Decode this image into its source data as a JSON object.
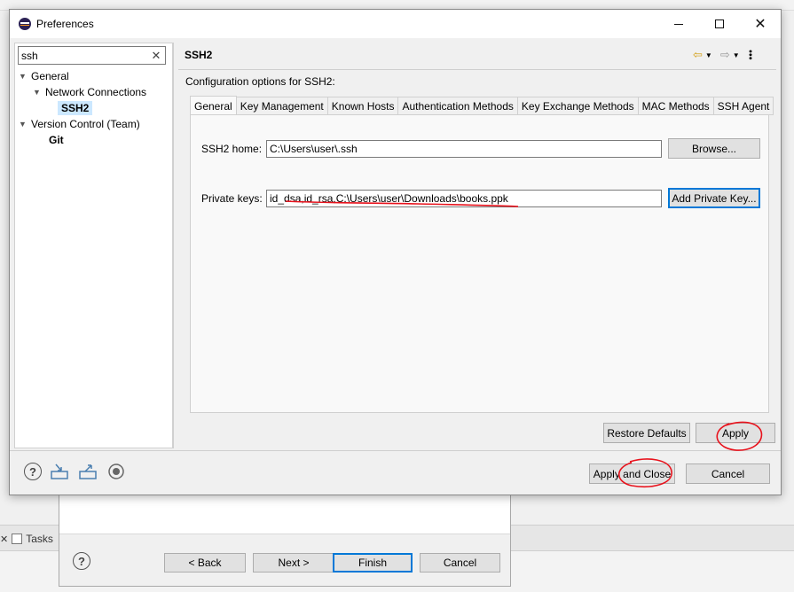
{
  "background": {
    "tasks_label": "Tasks"
  },
  "wizard": {
    "back_label": "< Back",
    "next_label": "Next >",
    "finish_label": "Finish",
    "cancel_label": "Cancel"
  },
  "dialog": {
    "title": "Preferences",
    "icon": "eclipse-icon"
  },
  "filter": {
    "value": "ssh",
    "clear_icon": "clear-icon"
  },
  "tree": {
    "general": "General",
    "network": "Network Connections",
    "ssh2": "SSH2",
    "version_control": "Version Control (Team)",
    "git": "Git"
  },
  "page": {
    "title": "SSH2",
    "description": "Configuration options for SSH2:"
  },
  "tabs": [
    {
      "label": "General",
      "active": true
    },
    {
      "label": "Key Management"
    },
    {
      "label": "Known Hosts"
    },
    {
      "label": "Authentication Methods"
    },
    {
      "label": "Key Exchange Methods"
    },
    {
      "label": "MAC Methods"
    },
    {
      "label": "SSH Agent"
    }
  ],
  "general_tab": {
    "ssh2_home_label": "SSH2 home:",
    "ssh2_home_value": "C:\\Users\\user\\.ssh",
    "browse_label": "Browse...",
    "private_keys_label": "Private keys:",
    "private_keys_value": "id_dsa,id_rsa,C:\\Users\\user\\Downloads\\books.ppk",
    "add_private_key_label": "Add Private Key..."
  },
  "buttons": {
    "restore_defaults": "Restore Defaults",
    "apply": "Apply",
    "apply_and_close": "Apply and Close",
    "cancel": "Cancel"
  },
  "colors": {
    "annotation": "#e8121c",
    "selection": "#cce8ff",
    "focus_border": "#0078d7",
    "back_arrow": "#d4a017"
  }
}
